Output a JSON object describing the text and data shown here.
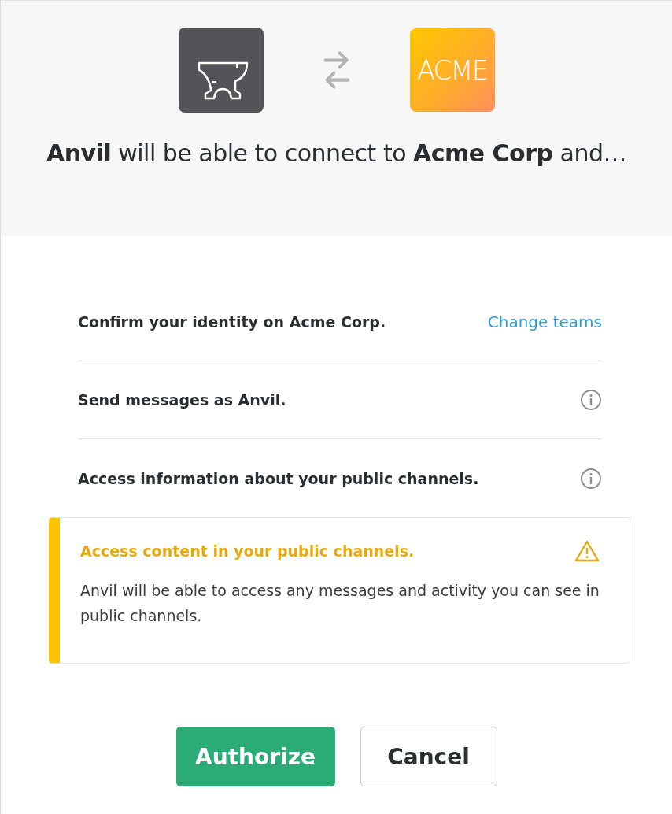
{
  "header": {
    "app_logo": {
      "kind": "anvil"
    },
    "team_logo": {
      "text": "ACME"
    },
    "headline": "**Anvil** will be able to connect to **Acme Corp** and…"
  },
  "permissions": [
    {
      "kind": "identity",
      "label": "Confirm your identity on Acme Corp.",
      "link": "Change teams"
    },
    {
      "kind": "info",
      "label": "Send messages as Anvil."
    },
    {
      "kind": "info",
      "label": "Access information about your public channels."
    },
    {
      "kind": "warning",
      "label": "Access content in your public channels.",
      "description": "Anvil will be able to access any messages and activity you can see in public channels."
    }
  ],
  "buttons": [
    {
      "kind": "primary",
      "label": "Authorize"
    },
    {
      "kind": "secondary",
      "label": "Cancel"
    }
  ]
}
